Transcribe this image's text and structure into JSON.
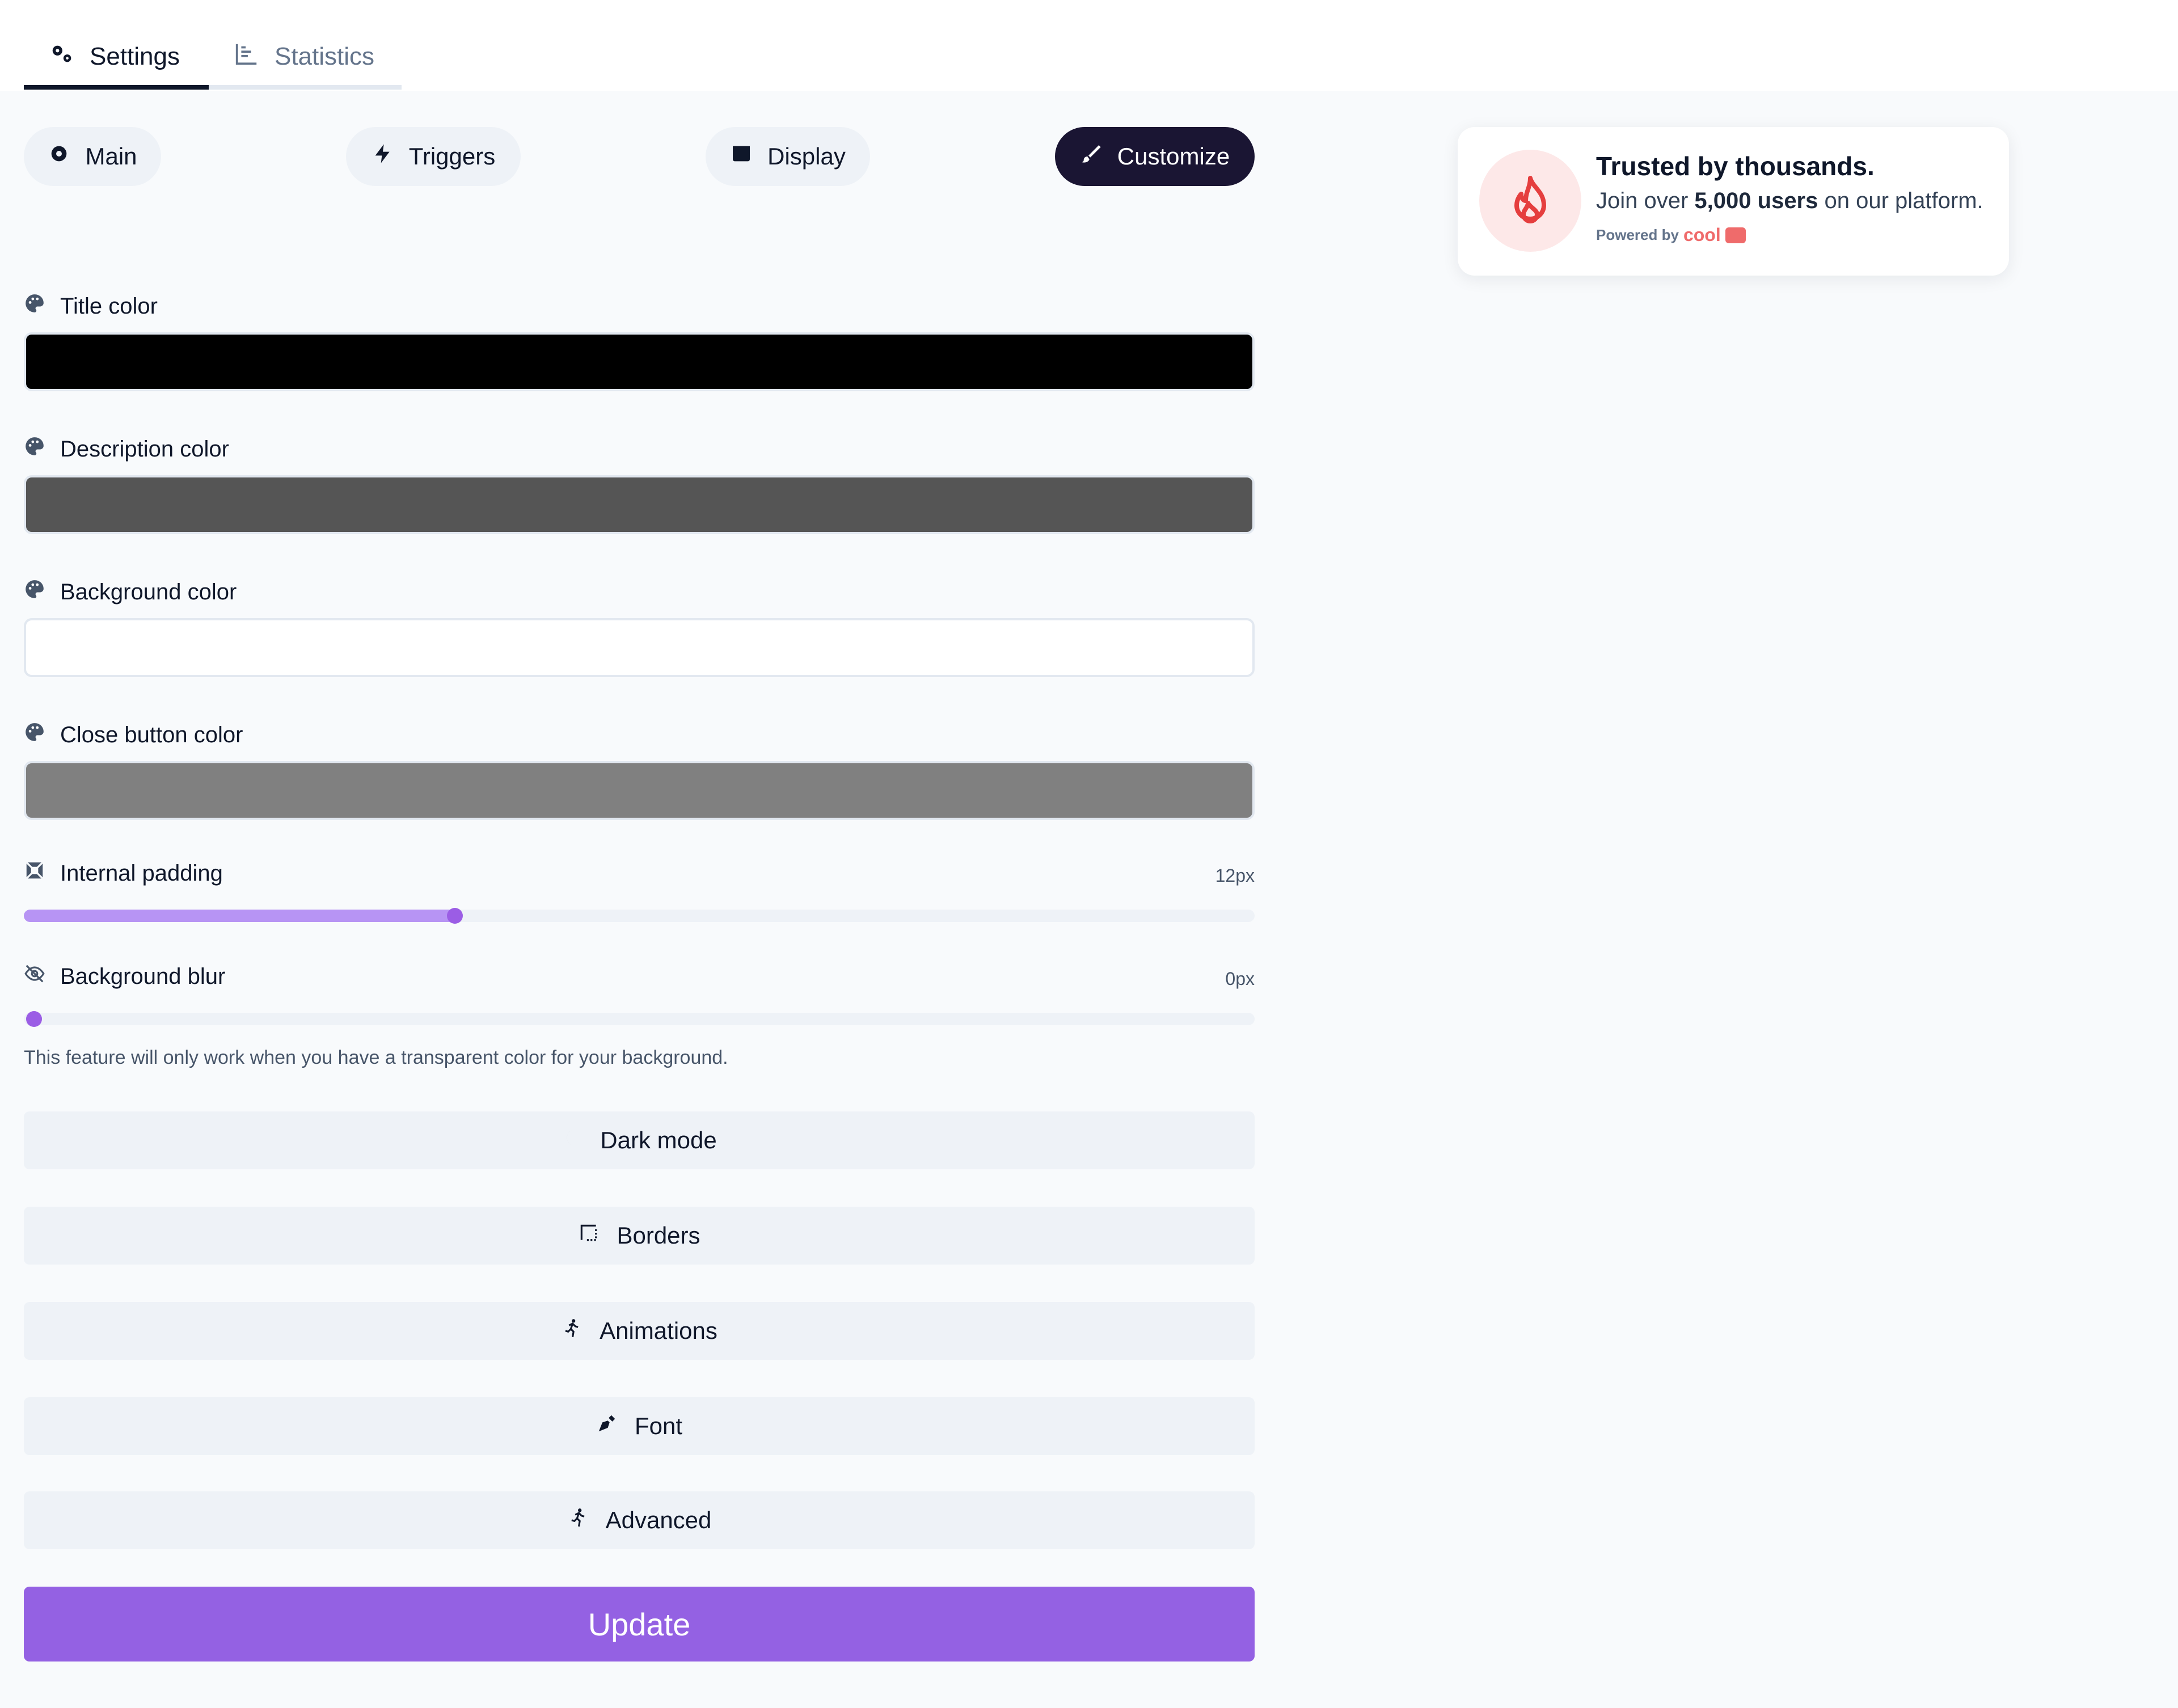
{
  "tabs": {
    "settings": "Settings",
    "statistics": "Statistics"
  },
  "subtabs": {
    "main": "Main",
    "triggers": "Triggers",
    "display": "Display",
    "customize": "Customize"
  },
  "fields": {
    "title_color": {
      "label": "Title color",
      "value": "#000000"
    },
    "description_color": {
      "label": "Description color",
      "value": "#555555"
    },
    "background_color": {
      "label": "Background color",
      "value": "#ffffff"
    },
    "close_button_color": {
      "label": "Close button color",
      "value": "#808080"
    }
  },
  "sliders": {
    "internal_padding": {
      "label": "Internal padding",
      "value_text": "12px",
      "fraction": 0.35
    },
    "background_blur": {
      "label": "Background blur",
      "value_text": "0px",
      "fraction": 0.0
    }
  },
  "hint": "This feature will only work when you have a transparent color for your background.",
  "sections": {
    "dark_mode": "Dark mode",
    "borders": "Borders",
    "animations": "Animations",
    "font": "Font",
    "advanced": "Advanced"
  },
  "update_label": "Update",
  "preview": {
    "title": "Trusted by thousands.",
    "desc_prefix": "Join over ",
    "desc_bold": "5,000 users",
    "desc_suffix": " on our platform.",
    "powered_by": "Powered by",
    "brand": "cool"
  },
  "colors": {
    "accent": "#9461e3",
    "slider_fill": "#b794f4",
    "customize_bg": "#1a1533",
    "icon_red": "#e53e3e"
  }
}
